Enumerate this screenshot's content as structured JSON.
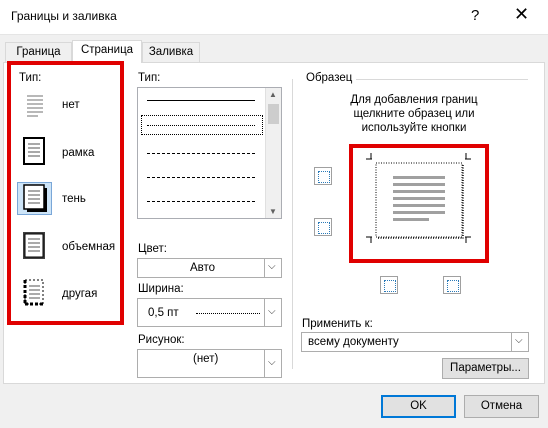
{
  "window": {
    "title": "Границы и заливка",
    "help_glyph": "?",
    "close_glyph": "✕"
  },
  "tabs": [
    {
      "label": "Граница",
      "active": false
    },
    {
      "label": "Страница",
      "active": true
    },
    {
      "label": "Заливка",
      "active": false
    }
  ],
  "settings": {
    "label": "Тип:",
    "items": [
      {
        "label": "нет",
        "icon": "setting-none-icon",
        "selected": false
      },
      {
        "label": "рамка",
        "icon": "setting-box-icon",
        "selected": false
      },
      {
        "label": "тень",
        "icon": "setting-shadow-icon",
        "selected": true
      },
      {
        "label": "объемная",
        "icon": "setting-3d-icon",
        "selected": false
      },
      {
        "label": "другая",
        "icon": "setting-custom-icon",
        "selected": false
      }
    ]
  },
  "style": {
    "label": "Тип:",
    "line_styles": [
      "solid",
      "dotted",
      "dash-small",
      "dash-medium",
      "dash-dot"
    ],
    "selected_index": 1
  },
  "color": {
    "label": "Цвет:",
    "value": "Авто"
  },
  "width": {
    "label": "Ширина:",
    "value": "0,5 пт"
  },
  "art": {
    "label": "Рисунок:",
    "value": "(нет)"
  },
  "preview": {
    "label": "Образец",
    "hint_lines": [
      "Для добавления границ",
      "щелкните образец или",
      "используйте кнопки"
    ]
  },
  "apply_to": {
    "label": "Применить к:",
    "value": "всему документу"
  },
  "buttons": {
    "options": "Параметры...",
    "ok": "OK",
    "cancel": "Отмена"
  },
  "colors": {
    "highlight": "#e00000",
    "default_button_border": "#0078d7",
    "selection_bg": "#cde4f7"
  }
}
